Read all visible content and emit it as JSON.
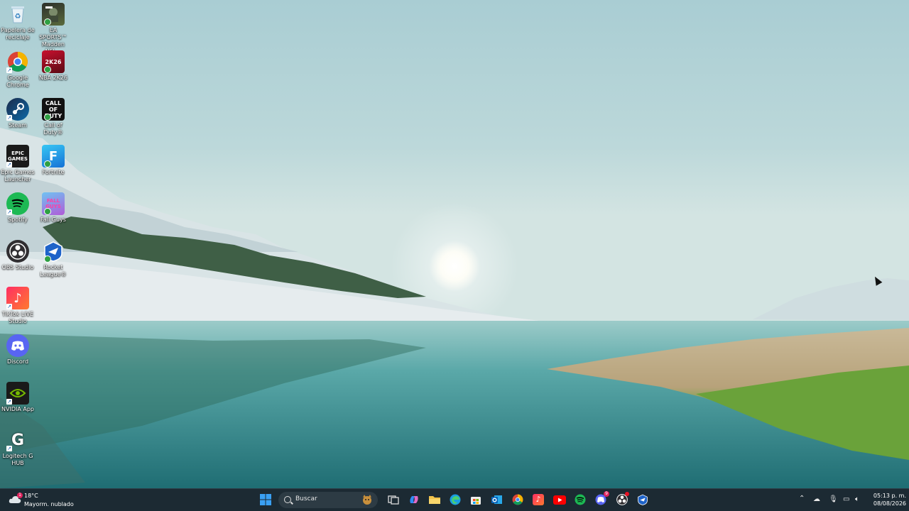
{
  "desktop": {
    "icons_col1": [
      {
        "label": "Papelera de reciclaje",
        "icon": "recycle-bin-icon"
      },
      {
        "label": "Google Chrome",
        "icon": "chrome-icon"
      },
      {
        "label": "Steam",
        "icon": "steam-icon"
      },
      {
        "label": "Epic Games Launcher",
        "icon": "epic-games-icon",
        "text": "EPIC GAMES"
      },
      {
        "label": "Spotify",
        "icon": "spotify-icon"
      },
      {
        "label": "OBS Studio",
        "icon": "obs-icon"
      },
      {
        "label": "TikTok LIVE Studio",
        "icon": "tiktok-icon"
      },
      {
        "label": "Discord",
        "icon": "discord-icon"
      },
      {
        "label": "NVIDIA App",
        "icon": "nvidia-icon"
      },
      {
        "label": "Logitech G HUB",
        "icon": "logitech-g-icon",
        "text": "G"
      }
    ],
    "icons_col2": [
      {
        "label": "EA SPORTS™ Madden NFL...",
        "icon": "madden-icon"
      },
      {
        "label": "NBA 2K26",
        "icon": "nba2k-icon",
        "text": "2K26"
      },
      {
        "label": "Call of Duty®",
        "icon": "call-of-duty-icon",
        "text": "CALL OF DUTY"
      },
      {
        "label": "Fortnite",
        "icon": "fortnite-icon",
        "text": "F"
      },
      {
        "label": "Fall Guys",
        "icon": "fall-guys-icon",
        "text": "FALL GUYS"
      },
      {
        "label": "Rocket League®",
        "icon": "rocket-league-icon"
      }
    ]
  },
  "taskbar": {
    "weather": {
      "temp": "18°C",
      "condition": "Mayorm. nublado",
      "badge": "1"
    },
    "search": {
      "placeholder": "Buscar"
    },
    "apps": [
      "start-icon",
      "task-view-icon",
      "copilot-icon",
      "file-explorer-icon",
      "edge-icon",
      "store-icon",
      "outlook-icon",
      "chrome-icon",
      "tiktok-icon",
      "youtube-icon",
      "spotify-icon",
      "discord-icon",
      "obs-icon",
      "rocket-league-icon"
    ],
    "discord_badge": "9",
    "clock": {
      "time": "05:13 p. m.",
      "date": "08/08/2026"
    }
  },
  "colors": {
    "taskbar": "#1c2a33",
    "accent": "#0078d4"
  }
}
